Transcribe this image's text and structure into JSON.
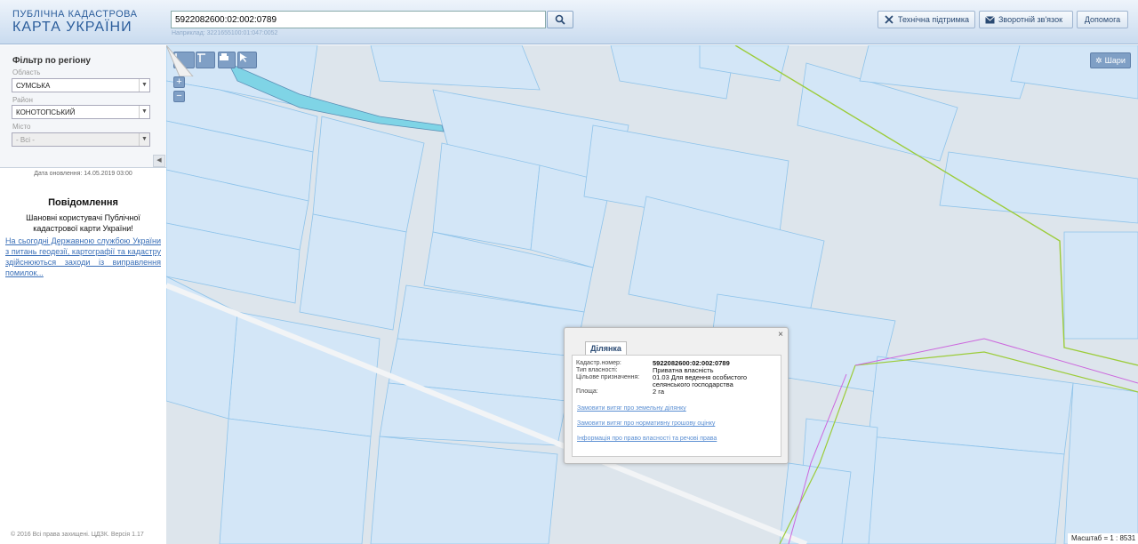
{
  "header": {
    "logo_line1": "ПУБЛІЧНА КАДАСТРОВА",
    "logo_line2": "КАРТА УКРАЇНИ",
    "search_value": "5922082600:02:002:0789",
    "search_hint": "Наприклад: 3221655100:01:047:0052",
    "support_label": "Технічна підтримка",
    "feedback_label": "Зворотній зв'язок",
    "help_label": "Допомога"
  },
  "filter": {
    "title": "Фільтр по регіону",
    "oblast_label": "Область",
    "oblast_value": "СУМСЬКА",
    "rayon_label": "Район",
    "rayon_value": "КОНОТОПСЬКИЙ",
    "misto_label": "Місто",
    "misto_value": "- Всі -"
  },
  "sidebar": {
    "update_date": "Дата оновлення: 14.05.2019 03:00",
    "messages_title": "Повідомлення",
    "messages_text": "Шановні користувачі Публічної кадастрової карти України!",
    "messages_link": "На сьогодні Державною службою України з питань геодезії, картографії та кадастру здійснюються заходи із виправлення помилок...",
    "copyright": "© 2016 Всі права захищені. ЦДЗК. Версія 1.17"
  },
  "toolbar": {
    "layers_label": "Шари",
    "zoom_in": "+",
    "zoom_out": "−"
  },
  "popup": {
    "tab": "Ділянка",
    "close": "×",
    "rows": [
      {
        "label": "Кадастр.номер:",
        "value": "5922082600:02:002:0789"
      },
      {
        "label": "Тип власності:",
        "value": "Приватна власність"
      },
      {
        "label": "Цільове призначення:",
        "value": "01.03 Для ведення особистого селянського господарства"
      },
      {
        "label": "Площа:",
        "value": "2 га"
      }
    ],
    "links": [
      "Замовити витяг про земельну ділянку",
      "Замовити витяг про нормативну грошову оцінку",
      "Інформація про право власності та речові права"
    ]
  },
  "scale": {
    "label": "Масштаб = 1 : 8531"
  },
  "colors": {
    "parcel_fill": "#d3e6f7",
    "parcel_stroke": "#8ec3ea",
    "boundary_green": "#9ccc3a",
    "boundary_magenta": "#cc66dd",
    "water": "#7fd4e6",
    "header_text": "#2b5d9b"
  }
}
